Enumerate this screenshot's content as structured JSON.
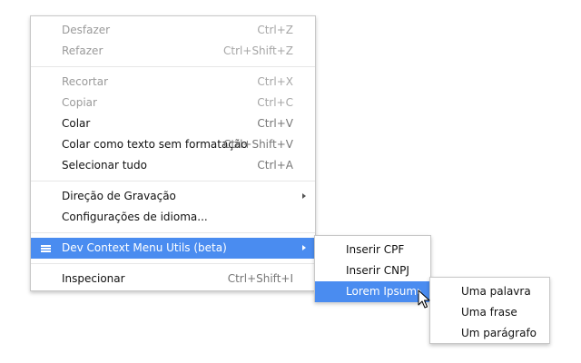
{
  "main_menu": {
    "group1": [
      {
        "label": "Desfazer",
        "shortcut": "Ctrl+Z"
      },
      {
        "label": "Refazer",
        "shortcut": "Ctrl+Shift+Z"
      }
    ],
    "group2": [
      {
        "label": "Recortar",
        "shortcut": "Ctrl+X"
      },
      {
        "label": "Copiar",
        "shortcut": "Ctrl+C"
      },
      {
        "label": "Colar",
        "shortcut": "Ctrl+V"
      },
      {
        "label": "Colar como texto sem formatação",
        "shortcut": "Ctrl+Shift+V"
      },
      {
        "label": "Selecionar tudo",
        "shortcut": "Ctrl+A"
      }
    ],
    "group3": [
      {
        "label": "Direção de Gravação"
      },
      {
        "label": "Configurações de idioma..."
      }
    ],
    "extension": {
      "label": "Dev Context Menu Utils (beta)",
      "icon": "hamburger-icon"
    },
    "inspect": {
      "label": "Inspecionar",
      "shortcut": "Ctrl+Shift+I"
    }
  },
  "submenu_1": {
    "items": [
      {
        "label": "Inserir CPF"
      },
      {
        "label": "Inserir CNPJ"
      },
      {
        "label": "Lorem Ipsum"
      }
    ]
  },
  "submenu_2": {
    "items": [
      {
        "label": "Uma palavra"
      },
      {
        "label": "Uma frase"
      },
      {
        "label": "Um parágrafo"
      }
    ]
  },
  "colors": {
    "highlight": "#4a8cf0",
    "disabled_text": "#9a9a9a",
    "shortcut_text": "#777777",
    "separator": "#e6e6e6"
  }
}
